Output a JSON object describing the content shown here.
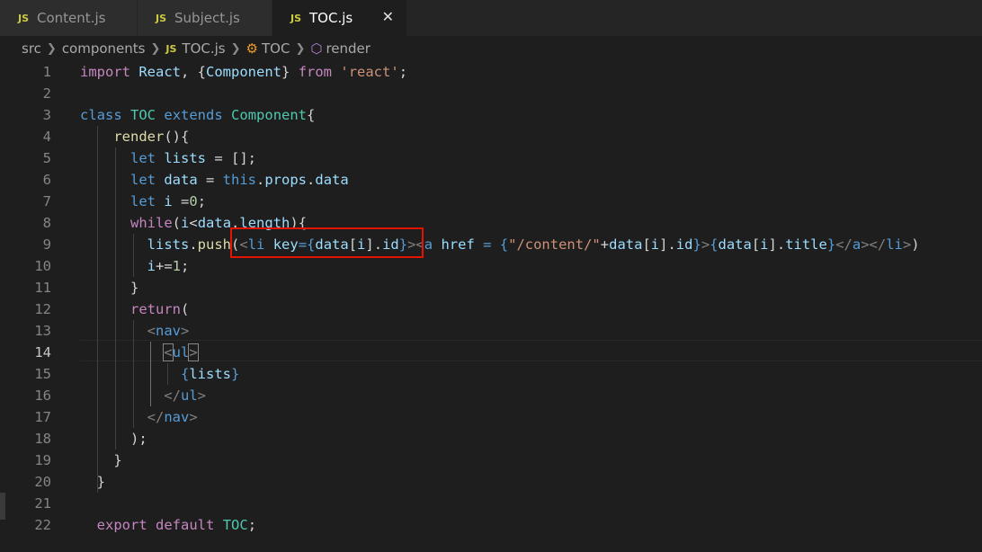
{
  "tabs": [
    {
      "badge": "JS",
      "label": "Content.js"
    },
    {
      "badge": "JS",
      "label": "Subject.js"
    },
    {
      "badge": "JS",
      "label": "TOC.js",
      "close": "✕"
    }
  ],
  "breadcrumb": {
    "src": "src",
    "components": "components",
    "file_badge": "JS",
    "file": "TOC.js",
    "class": "TOC",
    "method": "render"
  },
  "editor": {
    "active_line": 14,
    "line_numbers": [
      "1",
      "2",
      "3",
      "4",
      "5",
      "6",
      "7",
      "8",
      "9",
      "10",
      "11",
      "12",
      "13",
      "14",
      "15",
      "16",
      "17",
      "18",
      "19",
      "20",
      "21",
      "22"
    ],
    "code": {
      "l1": {
        "import": "import",
        "react_var": "React",
        "open": ", {",
        "component": "Component",
        "close": "} ",
        "from": "from",
        "module": "'react'",
        "semi": ";"
      },
      "l3": {
        "class_kw": "class",
        "toc": "TOC",
        "extends": "extends",
        "component": "Component",
        "brace": "{"
      },
      "l4": {
        "render": "render",
        "paren": "(){"
      },
      "l5": {
        "let": "let",
        "lists": "lists",
        "rest": " = [];"
      },
      "l6": {
        "let": "let",
        "data": "data",
        "eq": " = ",
        "this": "this",
        "dot1": ".",
        "props": "props",
        "dot2": ".",
        "data2": "data"
      },
      "l7": {
        "let": "let",
        "i": "i",
        "eq": " =",
        "zero": "0",
        "semi": ";"
      },
      "l8": {
        "while": "while",
        "open": "(",
        "i": "i",
        "lt": "<",
        "data": "data",
        "dot": ".",
        "length": "length",
        "close": "){"
      },
      "l9": {
        "lists": "lists",
        "dot": ".",
        "push": "push",
        "open": "(",
        "lt1": "<",
        "li": "li",
        "key": "key",
        "eqb": "={",
        "data1": "data",
        "b1": "[",
        "i1": "i",
        "b2": "].",
        "id1": "id",
        "cb1": "}",
        "gt1": ">",
        "lt2": "<",
        "a": "a",
        "href": "href",
        "eqsp": " = {",
        "path": "\"/content/\"",
        "plus": "+",
        "data2": "data",
        "b3": "[",
        "i2": "i",
        "b4": "].",
        "id2": "id",
        "cb2": "}",
        "gt2": ">",
        "ob3": "{",
        "data3": "data",
        "b5": "[",
        "i3": "i",
        "b6": "].",
        "title": "title",
        "cb3": "}",
        "closea": "</",
        "a2": "a",
        "gt3": "></",
        "li2": "li",
        "gt4": ">",
        "close": ")"
      },
      "l10": {
        "i": "i",
        "op": "+=",
        "one": "1",
        "semi": ";"
      },
      "l11": {
        "brace": "}"
      },
      "l12": {
        "return": "return",
        "paren": "("
      },
      "l13": {
        "lt": "<",
        "nav": "nav",
        "gt": ">"
      },
      "l14": {
        "lt": "<",
        "ul": "ul",
        "gt": ">"
      },
      "l15": {
        "open": "{",
        "lists": "lists",
        "close": "}"
      },
      "l16": {
        "lt": "</",
        "ul": "ul",
        "gt": ">"
      },
      "l17": {
        "lt": "</",
        "nav": "nav",
        "gt": ">"
      },
      "l18": {
        "text": ");"
      },
      "l19": {
        "brace": "}"
      },
      "l20": {
        "brace": "}"
      },
      "l22": {
        "export": "export",
        "default": "default",
        "toc": "TOC",
        "semi": ";"
      }
    }
  },
  "colors": {
    "background": "#1e1e1e",
    "keyword": "#569cd6",
    "control": "#c586c0",
    "variable": "#9cdcfe",
    "class": "#4ec9b0",
    "function": "#dcdcaa",
    "string": "#ce9178",
    "number": "#b5cea8",
    "highlight_box": "#e51400"
  }
}
